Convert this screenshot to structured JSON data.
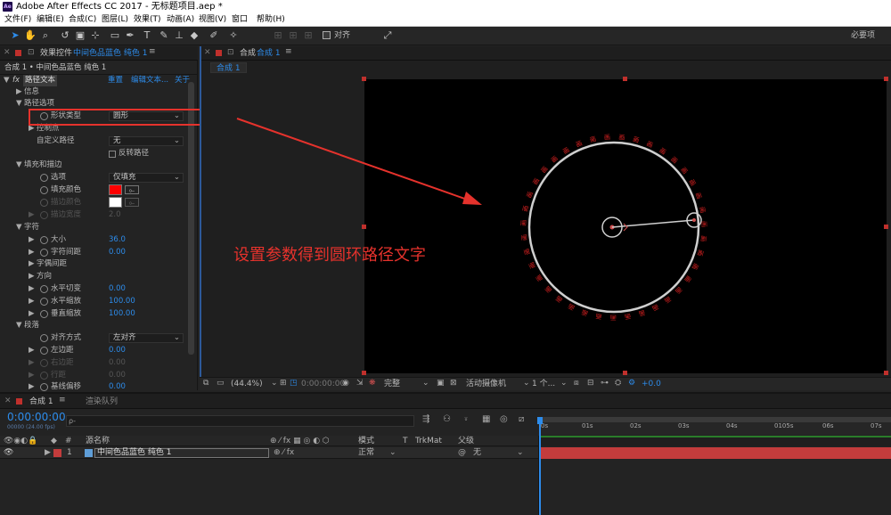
{
  "app": {
    "title": "Adobe After Effects CC 2017 - 无标题项目.aep *",
    "logo_text": "Ae"
  },
  "menu": [
    "文件(F)",
    "编辑(E)",
    "合成(C)",
    "图层(L)",
    "效果(T)",
    "动画(A)",
    "视图(V)",
    "窗口",
    "帮助(H)"
  ],
  "toolbar": {
    "align_label": "对齐",
    "workspace_label": "必要项"
  },
  "effect_controls": {
    "tab_label": "效果控件",
    "tab_layer": "中间色品蓝色 纯色 1",
    "breadcrumb": "合成 1 • 中间色品蓝色 纯色 1",
    "effect_name": "路径文本",
    "reset_label": "重置",
    "edit_text_label": "编辑文本...",
    "about_label": "关于",
    "rows": {
      "info": "信息",
      "path_options": "路径选项",
      "shape_type": "形状类型",
      "shape_type_value": "圆形",
      "control_points": "控制点",
      "custom_path": "自定义路径",
      "custom_path_value": "无",
      "reverse_path": "反转路径",
      "fill_stroke": "填充和描边",
      "options": "选项",
      "options_value": "仅填充",
      "fill_color": "填充颜色",
      "stroke_color": "描边颜色",
      "stroke_width": "描边宽度",
      "stroke_width_value": "2.0",
      "character": "字符",
      "size": "大小",
      "size_value": "36.0",
      "tracking": "字符间距",
      "tracking_value": "0.00",
      "kerning": "字偶间距",
      "orientation": "方向",
      "h_shear": "水平切变",
      "h_shear_value": "0.00",
      "h_scale": "水平缩放",
      "h_scale_value": "100.00",
      "v_scale": "垂直缩放",
      "v_scale_value": "100.00",
      "paragraph": "段落",
      "alignment": "对齐方式",
      "alignment_value": "左对齐",
      "left_margin": "左边距",
      "left_margin_value": "0.00",
      "right_margin": "右边距",
      "right_margin_value": "0.00",
      "line_spacing": "行距",
      "line_spacing_value": "0.00",
      "baseline_shift": "基线偏移",
      "baseline_shift_value": "0.00"
    },
    "fill_color_hex": "#ff0000",
    "stroke_color_hex": "#ffffff"
  },
  "composition": {
    "tab_label": "合成",
    "tab_name": "合成 1",
    "subtab": "合成 1",
    "annotation": "设置参数得到圆环路径文字",
    "path_text_chars": "画画画画画画画画画画画画画画画画画画画画画画画画画画画画画画画画画画画画画画画",
    "zoom": "(44.4%)",
    "timecode": "0:00:00:00",
    "resolution": "完整",
    "camera": "活动摄像机",
    "views": "1 个...",
    "exposure": "+0.0"
  },
  "timeline": {
    "tab_label": "合成 1",
    "render_queue": "渲染队列",
    "timecode": "0:00:00:00",
    "frame_info": "00000 (24.00 fps)",
    "search_placeholder": "ρ-",
    "columns": {
      "source_name": "源名称",
      "mode": "模式",
      "t": "T",
      "trkmat": "TrkMat",
      "parent": "父级"
    },
    "layer": {
      "number": "1",
      "name": "中间色品蓝色 纯色 1",
      "mode": "正常",
      "parent": "无"
    },
    "ruler": [
      "0s",
      "01s",
      "02s",
      "03s",
      "04s",
      "0105s",
      "06s",
      "07s"
    ],
    "layer_color": "#c33c3c"
  }
}
